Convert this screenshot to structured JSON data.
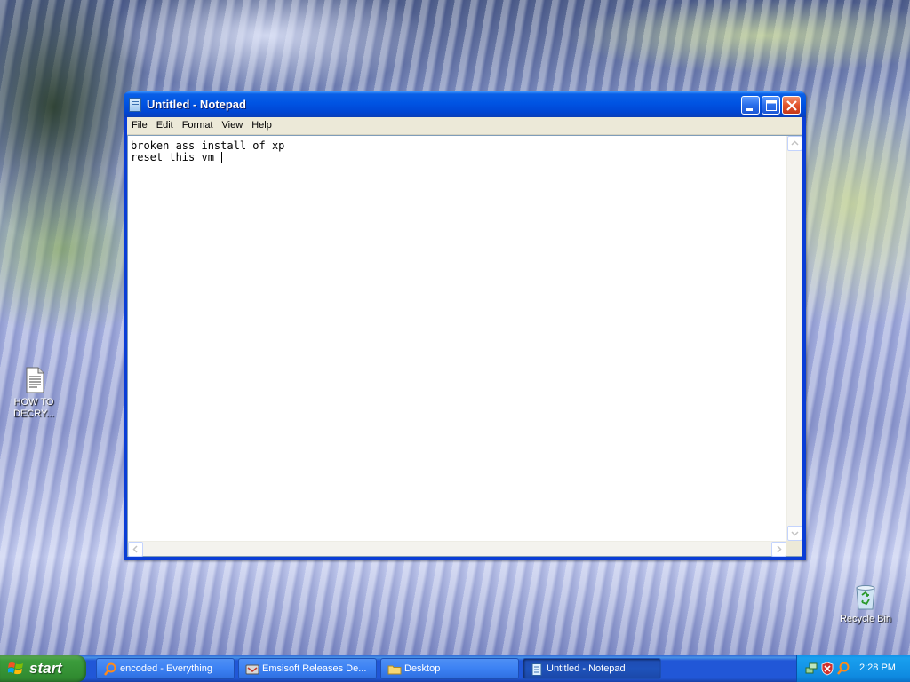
{
  "desktop": {
    "icons": [
      {
        "label_line1": "HOW TO",
        "label_line2": "DECRY...",
        "icon": "text-document-icon"
      },
      {
        "label_line1": "Recycle Bin",
        "label_line2": "",
        "icon": "recycle-bin-icon"
      }
    ]
  },
  "window": {
    "title": "Untitled - Notepad",
    "icon": "notepad-icon",
    "controls": {
      "minimize": "minimize-icon",
      "maximize": "maximize-icon",
      "close": "close-icon"
    },
    "menu": [
      "File",
      "Edit",
      "Format",
      "View",
      "Help"
    ],
    "content_lines": [
      "broken ass install of xp",
      "reset this vm "
    ]
  },
  "taskbar": {
    "start_label": "start",
    "tasks": [
      {
        "label": "encoded - Everything",
        "icon": "search-magnifier-icon",
        "active": false
      },
      {
        "label": "Emsisoft Releases De...",
        "icon": "emsisoft-icon",
        "active": false
      },
      {
        "label": "Desktop",
        "icon": "folder-icon",
        "active": false
      },
      {
        "label": "Untitled - Notepad",
        "icon": "notepad-icon",
        "active": true
      }
    ],
    "tray": {
      "icons": [
        "network-icon",
        "security-shield-icon",
        "search-magnifier-icon"
      ],
      "clock": "2:28 PM"
    }
  },
  "colors": {
    "titlebar": "#0054e3",
    "taskbar": "#2157d7",
    "start_button": "#3c9c3c",
    "close_button": "#e2532a",
    "tray": "#0f8ae0",
    "menubar": "#ece9d8"
  }
}
